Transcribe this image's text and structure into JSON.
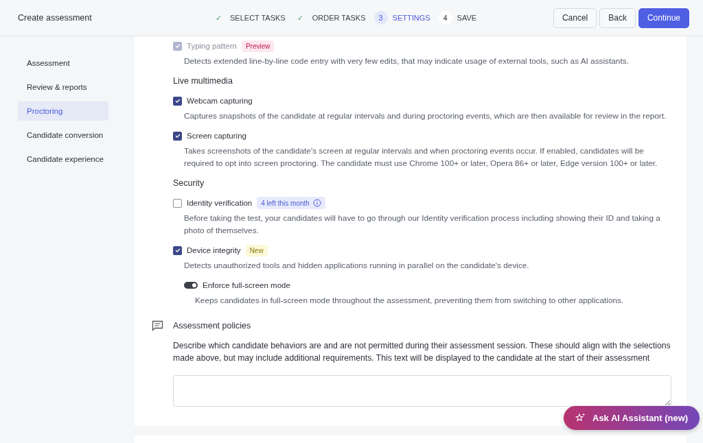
{
  "header": {
    "title": "Create assessment",
    "steps": [
      {
        "marker": "✓",
        "label": "SELECT TASKS",
        "kind": "done"
      },
      {
        "marker": "✓",
        "label": "ORDER TASKS",
        "kind": "done"
      },
      {
        "marker": "3",
        "label": "SETTINGS",
        "kind": "current"
      },
      {
        "marker": "4",
        "label": "SAVE",
        "kind": "todo"
      }
    ],
    "buttons": [
      {
        "label": "Cancel",
        "kind": "secondary"
      },
      {
        "label": "Back",
        "kind": "secondary"
      },
      {
        "label": "Continue",
        "kind": "primary"
      }
    ]
  },
  "sidebar": {
    "items": [
      {
        "label": "Assessment",
        "selected": false
      },
      {
        "label": "Review & reports",
        "selected": false
      },
      {
        "label": "Proctoring",
        "selected": true
      },
      {
        "label": "Candidate conversion",
        "selected": false
      },
      {
        "label": "Candidate experience",
        "selected": false
      }
    ]
  },
  "sections": [
    {
      "options": [
        {
          "kind": "checkbox",
          "label": "Typing pattern",
          "checked": true,
          "disabled": true,
          "badge": {
            "text": "Preview",
            "kind": "pink"
          },
          "description": "Detects extended line-by-line code entry with very few edits, that may indicate usage of external tools, such as AI assistants."
        }
      ]
    },
    {
      "heading": "Live multimedia",
      "options": [
        {
          "kind": "checkbox",
          "label": "Webcam capturing",
          "checked": true,
          "disabled": false,
          "description": "Captures snapshots of the candidate at regular intervals and during proctoring events, which are then available for review in the report."
        },
        {
          "kind": "checkbox",
          "label": "Screen capturing",
          "checked": true,
          "disabled": false,
          "description": "Takes screenshots of the candidate's screen at regular intervals and when proctoring events occur. If enabled, candidates will be required to opt into screen proctoring. The candidate must use Chrome 100+ or later, Opera 86+ or later, Edge version 100+ or later."
        }
      ]
    },
    {
      "heading": "Security",
      "options": [
        {
          "kind": "checkbox",
          "label": "Identity verification",
          "checked": false,
          "disabled": false,
          "badge": {
            "text": "4 left this month",
            "kind": "blue",
            "info": true
          },
          "description": "Before taking the test, your candidates will have to go through our Identity verification process including showing their ID and taking a photo of themselves."
        },
        {
          "kind": "checkbox",
          "label": "Device integrity",
          "checked": true,
          "disabled": false,
          "badge": {
            "text": "New",
            "kind": "yellow"
          },
          "description": "Detects unauthorized tools and hidden applications running in parallel on the candidate's device.",
          "children": [
            {
              "kind": "toggle",
              "label": "Enforce full-screen mode",
              "on": true,
              "description": "Keeps candidates in full-screen mode throughout the assessment, preventing them from switching to other applications."
            }
          ]
        }
      ]
    }
  ],
  "policies": {
    "title": "Assessment policies",
    "description": "Describe which candidate behaviors are and are not permitted during their assessment session. These should align with the selections made above, but may include additional requirements. This text will be displayed to the candidate at the start of their assessment"
  },
  "assistant": {
    "label": "Ask AI Assistant (new)"
  }
}
